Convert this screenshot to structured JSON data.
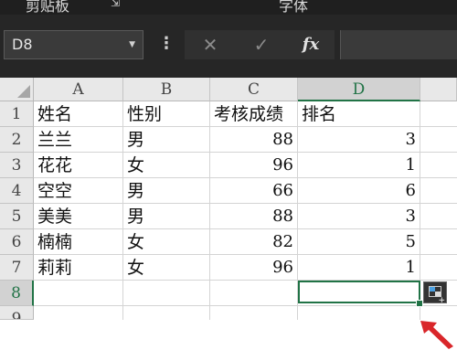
{
  "ribbon": {
    "clipboard_label": "剪贴板",
    "font_label": "字体",
    "launcher_icon": "dialog-launcher-icon"
  },
  "formula_bar": {
    "name_box": "D8",
    "cancel_icon": "✕",
    "enter_icon": "✓",
    "fx_label": "fx",
    "formula_value": ""
  },
  "sheet": {
    "columns": [
      "A",
      "B",
      "C",
      "D"
    ],
    "active_column": "D",
    "rows": [
      "1",
      "2",
      "3",
      "4",
      "5",
      "6",
      "7",
      "8",
      "9"
    ],
    "active_row": "8",
    "headers": [
      "姓名",
      "性别",
      "考核成绩",
      "排名"
    ],
    "data": [
      [
        "兰兰",
        "男",
        "88",
        "3"
      ],
      [
        "花花",
        "女",
        "96",
        "1"
      ],
      [
        "空空",
        "男",
        "66",
        "6"
      ],
      [
        "美美",
        "男",
        "88",
        "3"
      ],
      [
        "楠楠",
        "女",
        "82",
        "5"
      ],
      [
        "莉莉",
        "女",
        "96",
        "1"
      ]
    ],
    "selected_cell": "D8"
  },
  "colors": {
    "accent": "#217346",
    "arrow": "#d9262a",
    "ribbon_bg": "#1f1f1f",
    "formula_bar_bg": "#262626"
  },
  "icons": {
    "quick_analysis": "quick-analysis-icon",
    "annotation_arrow": "red-arrow-icon"
  }
}
